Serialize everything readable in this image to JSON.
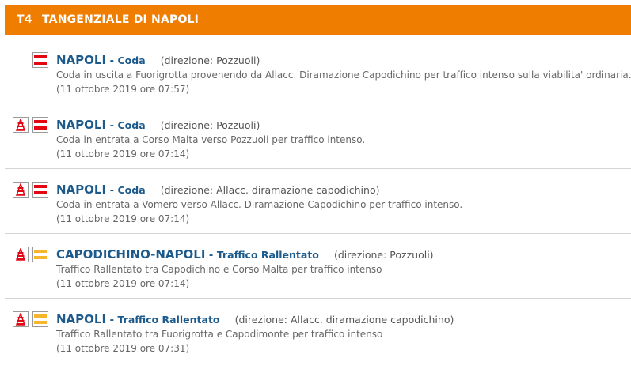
{
  "header": {
    "code": "T4",
    "title": "TANGENZIALE DI NAPOLI",
    "accent": "#ef7d00"
  },
  "items": [
    {
      "road": "NAPOLI",
      "event": "Coda",
      "direction": "(direzione: Pozzuoli)",
      "description": "Coda in uscita a Fuorigrotta provenendo da Allacc. Diramazione Capodichino per traffico intenso sulla viabilita' ordinaria.",
      "timestamp": "(11 ottobre 2019 ore 07:57)",
      "icons": [
        "coda-icon"
      ]
    },
    {
      "road": "NAPOLI",
      "event": "Coda",
      "direction": "(direzione: Pozzuoli)",
      "description": "Coda in entrata a Corso Malta verso Pozzuoli per traffico intenso.",
      "timestamp": "(11 ottobre 2019 ore 07:14)",
      "icons": [
        "ingresso-icon",
        "coda-icon"
      ]
    },
    {
      "road": "NAPOLI",
      "event": "Coda",
      "direction": "(direzione: Allacc. diramazione capodichino)",
      "description": "Coda in entrata a Vomero verso Allacc. Diramazione Capodichino per traffico intenso.",
      "timestamp": "(11 ottobre 2019 ore 07:14)",
      "icons": [
        "ingresso-icon",
        "coda-icon"
      ]
    },
    {
      "road": "CAPODICHINO-NAPOLI",
      "event": "Traffico Rallentato",
      "direction": "(direzione: Pozzuoli)",
      "description": "Traffico Rallentato tra Capodichino e Corso Malta per traffico intenso",
      "timestamp": "(11 ottobre 2019 ore 07:14)",
      "icons": [
        "ingresso-icon",
        "rallentato-icon"
      ]
    },
    {
      "road": "NAPOLI",
      "event": "Traffico Rallentato",
      "direction": "(direzione: Allacc. diramazione capodichino)",
      "description": "Traffico Rallentato tra Fuorigrotta e Capodimonte per traffico intenso",
      "timestamp": "(11 ottobre 2019 ore 07:31)",
      "icons": [
        "ingresso-icon",
        "rallentato-icon"
      ]
    }
  ],
  "separator": " - "
}
